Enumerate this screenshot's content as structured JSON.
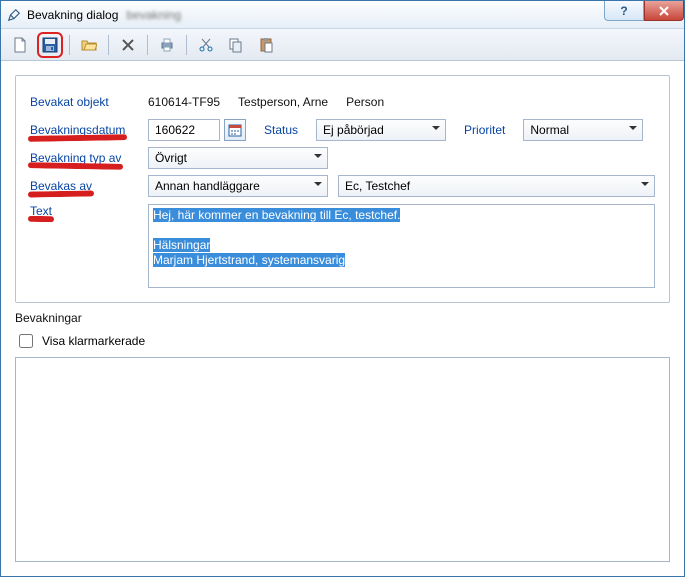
{
  "window": {
    "title": "Bevakning dialog",
    "help_tooltip": "?",
    "close_tooltip": "X"
  },
  "toolbar": {
    "icons": {
      "new": "new-file-icon",
      "save": "floppy-save-icon",
      "open": "open-folder-icon",
      "delete": "delete-icon",
      "print": "print-icon",
      "cut": "cut-icon",
      "copy": "copy-icon",
      "paste": "paste-icon"
    }
  },
  "form": {
    "object_label": "Bevakat objekt",
    "object_value_id": "610614-TF95",
    "object_value_name": "Testperson, Arne",
    "object_value_type": "Person",
    "date_label": "Bevakningsdatum",
    "date_value": "160622",
    "status_label": "Status",
    "status_value": "Ej påbörjad",
    "priority_label": "Prioritet",
    "priority_value": "Normal",
    "type_label": "Bevakning typ av",
    "type_value": "Övrigt",
    "watchedby_label": "Bevakas av",
    "watchedby_role": "Annan handläggare",
    "watchedby_person": "Ec, Testchef",
    "text_label": "Text",
    "text_line1": "Hej, här kommer en bevakning till Ec, testchef.",
    "text_line2": "",
    "text_line3": "Hälsningar",
    "text_line4": "Marjam Hjertstrand, systemansvarig"
  },
  "list": {
    "heading": "Bevakningar",
    "chk_label": "Visa klarmarkerade"
  }
}
